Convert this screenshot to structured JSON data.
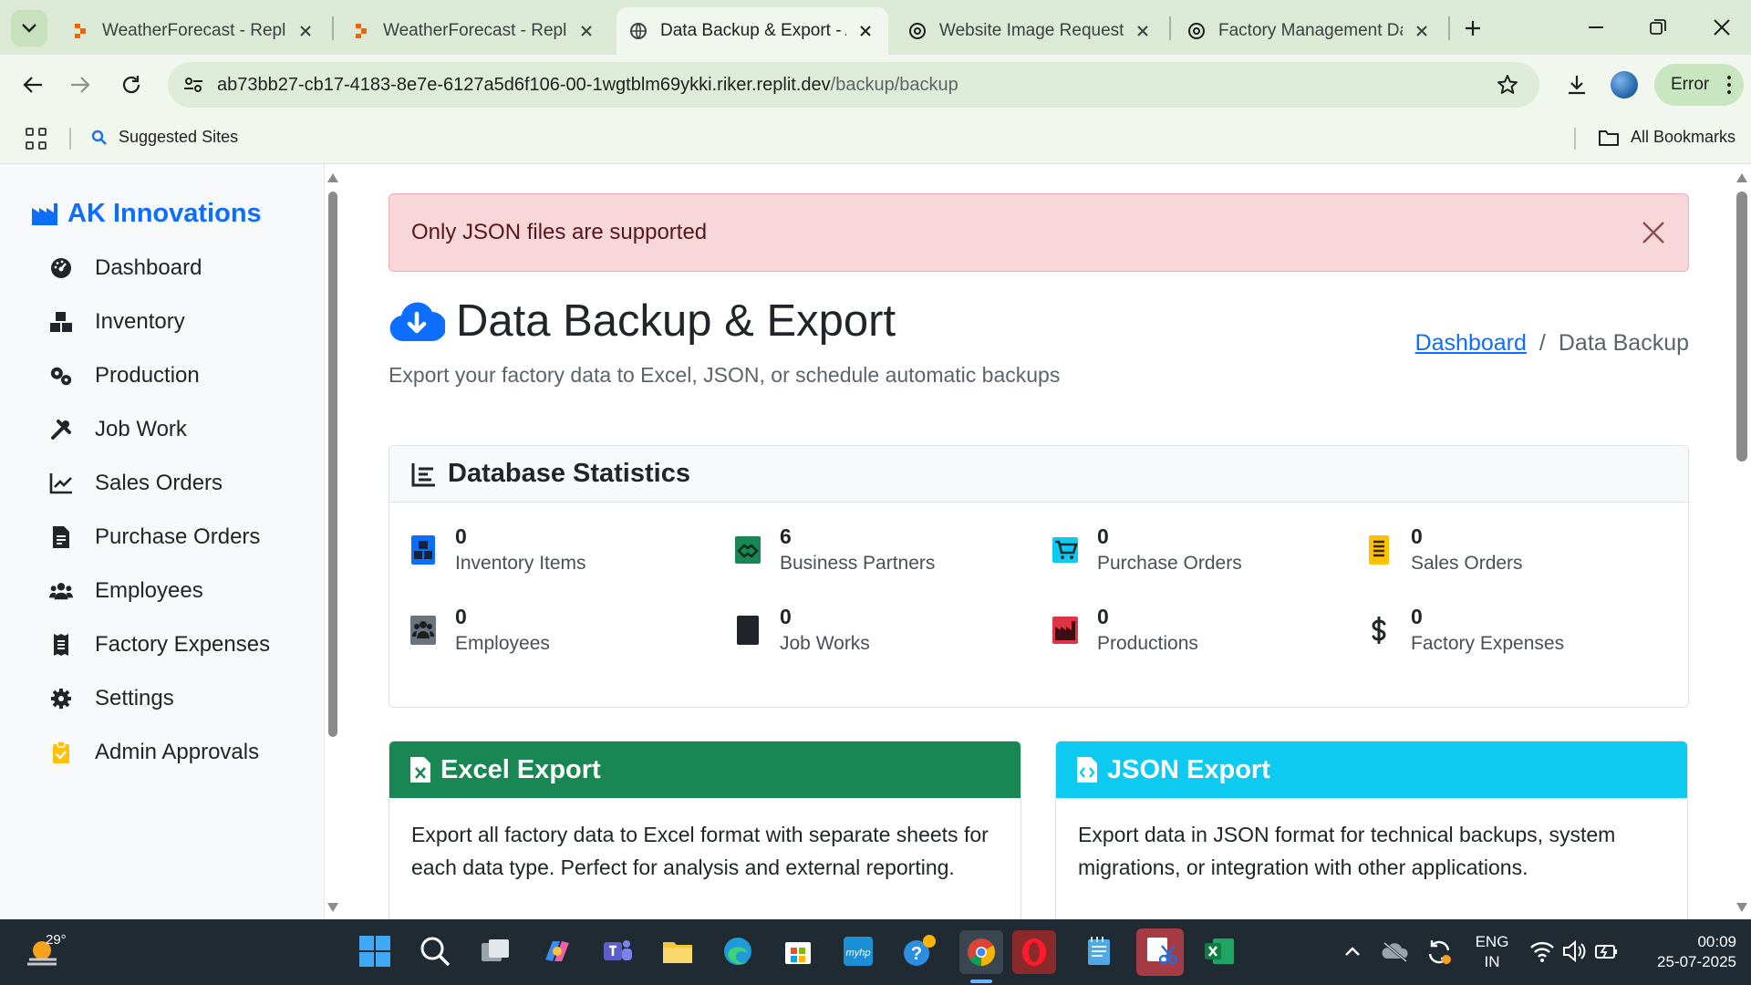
{
  "browser": {
    "tabs": [
      {
        "title": "WeatherForecast - Replit",
        "favicon": "replit-icon",
        "active": false
      },
      {
        "title": "WeatherForecast - Replit",
        "favicon": "replit-icon",
        "active": false
      },
      {
        "title": "Data Backup & Export - A",
        "favicon": "globe-icon",
        "active": true
      },
      {
        "title": "Website Image Request",
        "favicon": "chatgpt-icon",
        "active": false
      },
      {
        "title": "Factory Management Dat",
        "favicon": "chatgpt-icon",
        "active": false
      }
    ],
    "url_host": "ab73bb27-cb17-4183-8e7e-6127a5d6f106-00-1wgtblm69ykki.riker.replit.dev",
    "url_path": "/backup/backup",
    "profile_status": "Error",
    "bookmarks": {
      "suggested": "Suggested Sites",
      "all": "All Bookmarks"
    }
  },
  "app": {
    "brand": "AK Innovations",
    "nav": [
      {
        "label": "Dashboard",
        "icon": "gauge-icon"
      },
      {
        "label": "Inventory",
        "icon": "boxes-icon"
      },
      {
        "label": "Production",
        "icon": "gears-icon"
      },
      {
        "label": "Job Work",
        "icon": "tools-icon"
      },
      {
        "label": "Sales Orders",
        "icon": "chart-line-icon"
      },
      {
        "label": "Purchase Orders",
        "icon": "file-invoice-icon"
      },
      {
        "label": "Employees",
        "icon": "users-icon"
      },
      {
        "label": "Factory Expenses",
        "icon": "receipt-icon"
      },
      {
        "label": "Settings",
        "icon": "cog-icon"
      },
      {
        "label": "Admin Approvals",
        "icon": "clipboard-check-icon"
      }
    ]
  },
  "alert": {
    "message": "Only JSON files are supported"
  },
  "header": {
    "title": "Data Backup & Export",
    "subtitle": "Export your factory data to Excel, JSON, or schedule automatic backups",
    "breadcrumb": {
      "home": "Dashboard",
      "current": "Data Backup",
      "divider": "/"
    }
  },
  "stats": {
    "title": "Database Statistics",
    "items": [
      {
        "value": "0",
        "label": "Inventory Items",
        "icon": "boxes-icon",
        "color": "#0d6efd"
      },
      {
        "value": "6",
        "label": "Business Partners",
        "icon": "handshake-icon",
        "color": "#198754"
      },
      {
        "value": "0",
        "label": "Purchase Orders",
        "icon": "cart-icon",
        "color": "#0dcaf0"
      },
      {
        "value": "0",
        "label": "Sales Orders",
        "icon": "receipt-icon",
        "color": "#ffc107"
      },
      {
        "value": "0",
        "label": "Employees",
        "icon": "users-icon",
        "color": "#6c757d"
      },
      {
        "value": "0",
        "label": "Job Works",
        "icon": "tools-icon",
        "color": "#212529"
      },
      {
        "value": "0",
        "label": "Productions",
        "icon": "industry-icon",
        "color": "#dc3545"
      },
      {
        "value": "0",
        "label": "Factory Expenses",
        "icon": "dollar-icon",
        "color": "#212529"
      }
    ]
  },
  "exports": {
    "excel": {
      "title": "Excel Export",
      "color": "#198754",
      "description": "Export all factory data to Excel format with separate sheets for each data type. Perfect for analysis and external reporting."
    },
    "json": {
      "title": "JSON Export",
      "color": "#0dcaf0",
      "description": "Export data in JSON format for technical backups, system migrations, or integration with other applications."
    }
  },
  "taskbar": {
    "temperature": "29°",
    "language": "ENG",
    "region": "IN",
    "time": "00:09",
    "date": "25-07-2025"
  }
}
